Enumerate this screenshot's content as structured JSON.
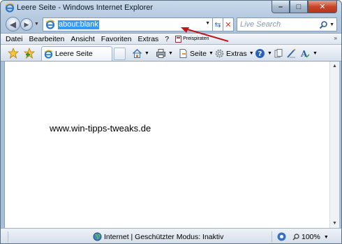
{
  "window": {
    "title": "Leere Seite - Windows Internet Explorer",
    "controls": {
      "minimize": "–",
      "maximize": "□",
      "close": "✕"
    }
  },
  "address_bar": {
    "url": "about:blank",
    "search_placeholder": "Live Search"
  },
  "menu": {
    "items": [
      "Datei",
      "Bearbeiten",
      "Ansicht",
      "Favoriten",
      "Extras",
      "?"
    ],
    "extension_label": "Preispiraten"
  },
  "command_bar": {
    "tab_title": "Leere Seite",
    "page_label": "Seite",
    "tools_label": "Extras"
  },
  "page": {
    "text": "www.win-tipps-tweaks.de"
  },
  "status_bar": {
    "zone_text": "Internet | Geschützter Modus: Inaktiv",
    "zoom": "100%"
  },
  "colors": {
    "selection": "#3399ff",
    "annotation_arrow": "#c0171f",
    "close_button": "#c7462a"
  },
  "icons": [
    "ie-icon",
    "back-arrow-icon",
    "forward-arrow-icon",
    "refresh-icon",
    "stop-icon",
    "search-icon",
    "favorites-star-icon",
    "add-favorites-icon",
    "home-icon",
    "print-icon",
    "page-icon",
    "gear-icon",
    "help-icon",
    "research-icon",
    "blog-icon",
    "font-size-icon",
    "globe-icon",
    "zoom-icon"
  ]
}
